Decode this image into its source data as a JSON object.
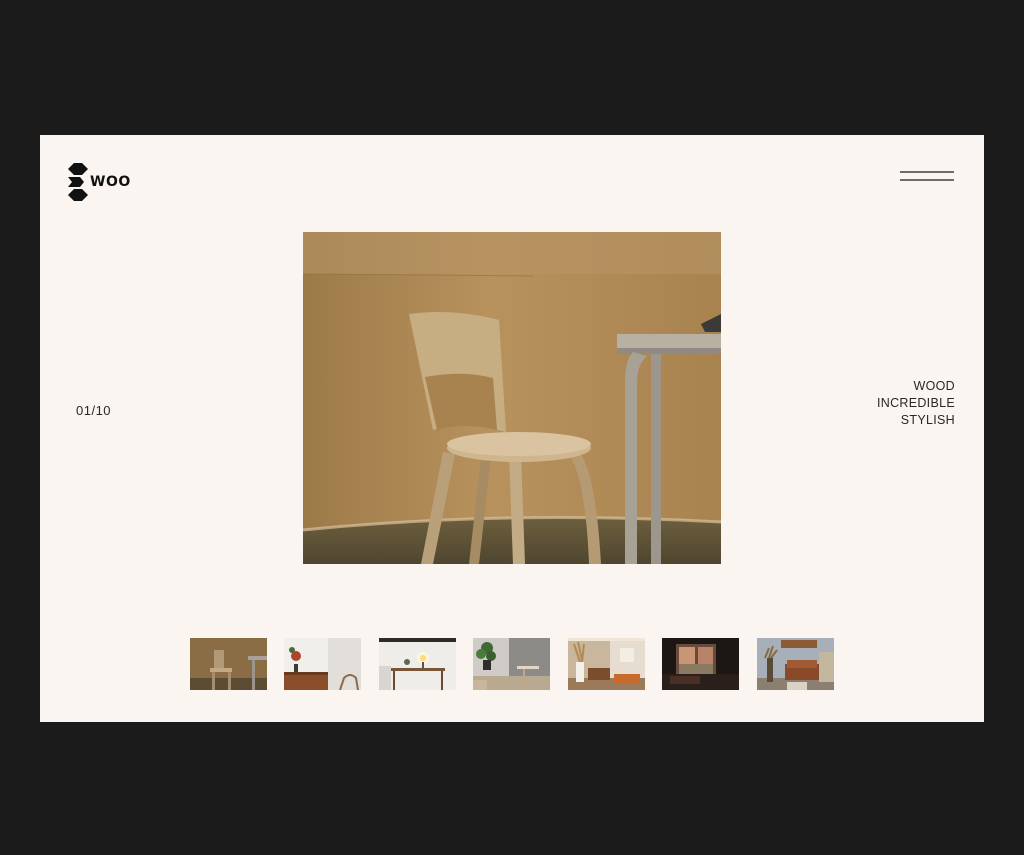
{
  "brand": {
    "name": "WOO",
    "logo_icon": "woo-logo-icon"
  },
  "header": {
    "menu_icon": "hamburger-menu-icon"
  },
  "slider": {
    "counter": "01/10"
  },
  "taglines": [
    "WOOD",
    "INCREDIBLE",
    "STYLISH"
  ],
  "thumbnails": [
    {
      "name": "thumb-chair-table"
    },
    {
      "name": "thumb-sideboard-plant"
    },
    {
      "name": "thumb-desk-lamp"
    },
    {
      "name": "thumb-plant-room"
    },
    {
      "name": "thumb-living-room"
    },
    {
      "name": "thumb-dark-window"
    },
    {
      "name": "thumb-sofa-room"
    }
  ],
  "colors": {
    "page_bg": "#1b1b1b",
    "frame_bg": "#faf5f0",
    "text": "#2a2724",
    "menu_lines": "#6f6b67"
  }
}
